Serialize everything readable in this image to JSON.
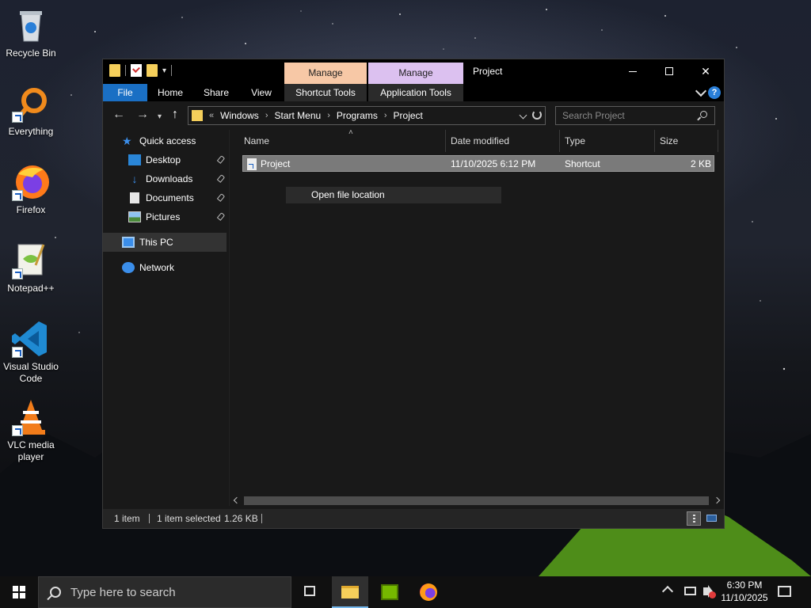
{
  "desktop": {
    "icons": [
      {
        "label": "Recycle Bin",
        "icon": "recycle-bin-icon"
      },
      {
        "label": "Everything",
        "icon": "everything-search-icon"
      },
      {
        "label": "Firefox",
        "icon": "firefox-icon"
      },
      {
        "label": "Notepad++",
        "icon": "notepad-plus-plus-icon"
      },
      {
        "label": "Visual Studio Code",
        "icon": "vscode-icon"
      },
      {
        "label": "VLC media player",
        "icon": "vlc-icon"
      }
    ]
  },
  "window": {
    "title": "Project",
    "context_tabs": [
      {
        "group": "Manage",
        "tab": "Shortcut Tools",
        "color": "#f7c8a6"
      },
      {
        "group": "Manage",
        "tab": "Application Tools",
        "color": "#dcc1f0"
      }
    ],
    "ribbon_tabs": [
      "File",
      "Home",
      "Share",
      "View"
    ],
    "help_label": "?",
    "address": {
      "prefix": "«",
      "crumbs": [
        "Windows",
        "Start Menu",
        "Programs",
        "Project"
      ]
    },
    "search_placeholder": "Search Project",
    "nav_pane": {
      "quick_access": "Quick access",
      "items": [
        {
          "label": "Desktop",
          "pinned": true
        },
        {
          "label": "Downloads",
          "pinned": true
        },
        {
          "label": "Documents",
          "pinned": true
        },
        {
          "label": "Pictures",
          "pinned": true
        }
      ],
      "this_pc": "This PC",
      "network": "Network"
    },
    "columns": [
      "Name",
      "Date modified",
      "Type",
      "Size"
    ],
    "files": [
      {
        "name": "Project",
        "date_modified": "11/10/2025 6:12 PM",
        "type": "Shortcut",
        "size": "2 KB"
      }
    ],
    "context_menu": [
      "Open file location"
    ],
    "status": {
      "count": "1 item",
      "selection": "1 item selected",
      "selection_size": "1.26 KB"
    }
  },
  "taskbar": {
    "search_placeholder": "Type here to search",
    "clock_time": "6:30 PM",
    "clock_date": "11/10/2025",
    "accent": "#76b9ed"
  }
}
